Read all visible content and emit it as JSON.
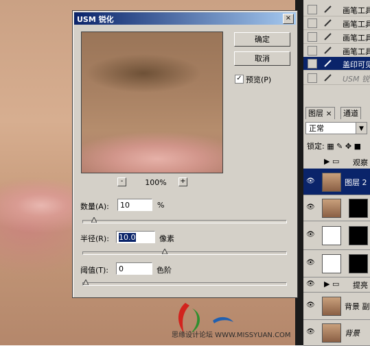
{
  "dialog": {
    "title": "USM 锐化",
    "close_glyph": "×",
    "zoom_minus": "-",
    "zoom_plus": "+",
    "zoom_value": "100%",
    "ok_label": "确定",
    "cancel_label": "取消",
    "preview_checked": "✓",
    "preview_label": "预览(P)",
    "amount_label": "数量(A):",
    "amount_value": "10",
    "amount_unit": "%",
    "amount_fraction": 0.04,
    "radius_label": "半径(R):",
    "radius_value": "10.0",
    "radius_unit": "像素",
    "radius_fraction": 0.4,
    "threshold_label": "阈值(T):",
    "threshold_value": "0",
    "threshold_unit": "色阶",
    "threshold_fraction": 0.0
  },
  "history": {
    "items": [
      {
        "label": "画笔工具",
        "state": "normal"
      },
      {
        "label": "画笔工具",
        "state": "normal"
      },
      {
        "label": "画笔工具",
        "state": "normal"
      },
      {
        "label": "画笔工具",
        "state": "normal"
      },
      {
        "label": "盖印可见",
        "state": "active"
      },
      {
        "label": "USM 锐化",
        "state": "dim"
      }
    ]
  },
  "layers_panel": {
    "tab_layers": "图层",
    "tab_channels": "通道",
    "blend_mode": "正常",
    "lock_label": "锁定:",
    "layers": [
      {
        "name": "观察",
        "kind": "group"
      },
      {
        "name": "图层 2",
        "kind": "layer",
        "active": true
      },
      {
        "name": "",
        "kind": "masked"
      },
      {
        "name": "",
        "kind": "curves"
      },
      {
        "name": "",
        "kind": "curves-mask"
      },
      {
        "name": "提亮",
        "kind": "group"
      },
      {
        "name": "背景 副本",
        "kind": "layer"
      },
      {
        "name": "背景",
        "kind": "background"
      }
    ]
  },
  "watermark": {
    "text": "思缘设计论坛 WWW.MISSYUAN.COM"
  }
}
